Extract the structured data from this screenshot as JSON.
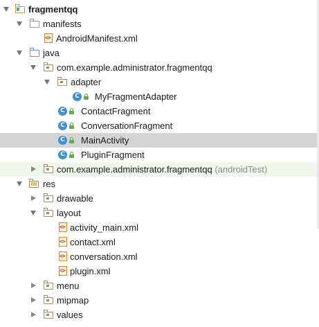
{
  "project_tree": {
    "project": {
      "name": "fragmentqq"
    },
    "manifests": {
      "label": "manifests",
      "files": [
        "AndroidManifest.xml"
      ]
    },
    "java": {
      "label": "java",
      "main_package": "com.example.administrator.fragmentqq",
      "adapter": {
        "label": "adapter",
        "classes": [
          "MyFragmentAdapter"
        ]
      },
      "classes": [
        "ContactFragment",
        "ConversationFragment",
        "MainActivity",
        "PluginFragment"
      ],
      "test_package": {
        "name": "com.example.administrator.fragmentqq",
        "suffix": "(androidTest)"
      }
    },
    "res": {
      "label": "res",
      "drawable": "drawable",
      "layout": {
        "label": "layout",
        "files": [
          "activity_main.xml",
          "contact.xml",
          "conversation.xml",
          "plugin.xml"
        ]
      },
      "menu": "menu",
      "mipmap": "mipmap",
      "values": "values"
    },
    "selected_item": "MainActivity",
    "class_icon_letter": "C",
    "colors": {
      "selection": "#d4d4d4",
      "test_source_bg": "#f1f7ec",
      "class_icon": "#3f8fd2"
    }
  }
}
